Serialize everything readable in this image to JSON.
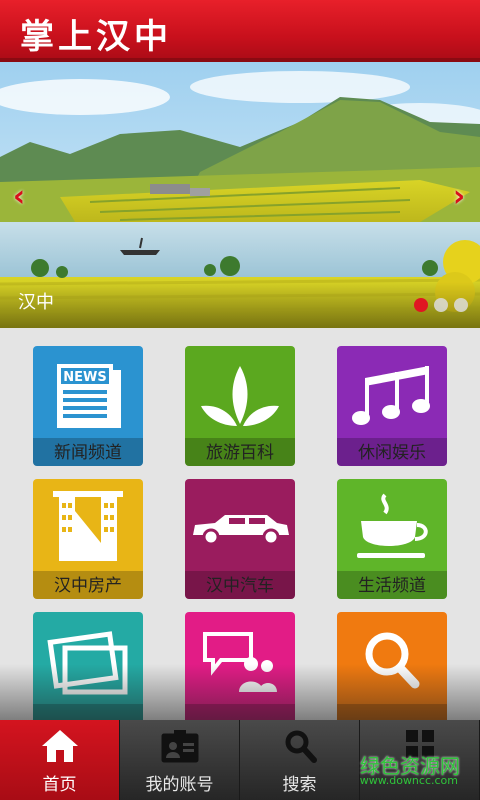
{
  "header": {
    "title": "掌上汉中"
  },
  "banner": {
    "caption": "汉中",
    "prev_arrow": "‹",
    "next_arrow": "›",
    "slide_count": 3,
    "active_slide": 1
  },
  "tiles": [
    {
      "label": "新闻频道",
      "icon": "newspaper-icon",
      "color": "#2b93d0"
    },
    {
      "label": "旅游百科",
      "icon": "leaf-icon",
      "color": "#5ba81f"
    },
    {
      "label": "休闲娱乐",
      "icon": "music-notes-icon",
      "color": "#8b2ab5"
    },
    {
      "label": "汉中房产",
      "icon": "building-icon",
      "color": "#e8b516"
    },
    {
      "label": "汉中汽车",
      "icon": "car-icon",
      "color": "#9a1c5e"
    },
    {
      "label": "生活频道",
      "icon": "coffee-cup-icon",
      "color": "#5fb529"
    },
    {
      "label": "",
      "icon": "photos-icon",
      "color": "#24aaa4"
    },
    {
      "label": "",
      "icon": "chat-people-icon",
      "color": "#e21c86"
    },
    {
      "label": "",
      "icon": "magnifier-icon",
      "color": "#f07a10"
    }
  ],
  "nav": [
    {
      "label": "首页",
      "icon": "home-icon",
      "active": true
    },
    {
      "label": "我的账号",
      "icon": "id-card-icon",
      "active": false
    },
    {
      "label": "搜索",
      "icon": "search-icon",
      "active": false
    },
    {
      "label": "",
      "icon": "grid-icon",
      "active": false
    }
  ],
  "watermark": {
    "text": "绿色资源网",
    "url": "www.downcc.com"
  },
  "colors": {
    "accent": "#d4141f"
  }
}
